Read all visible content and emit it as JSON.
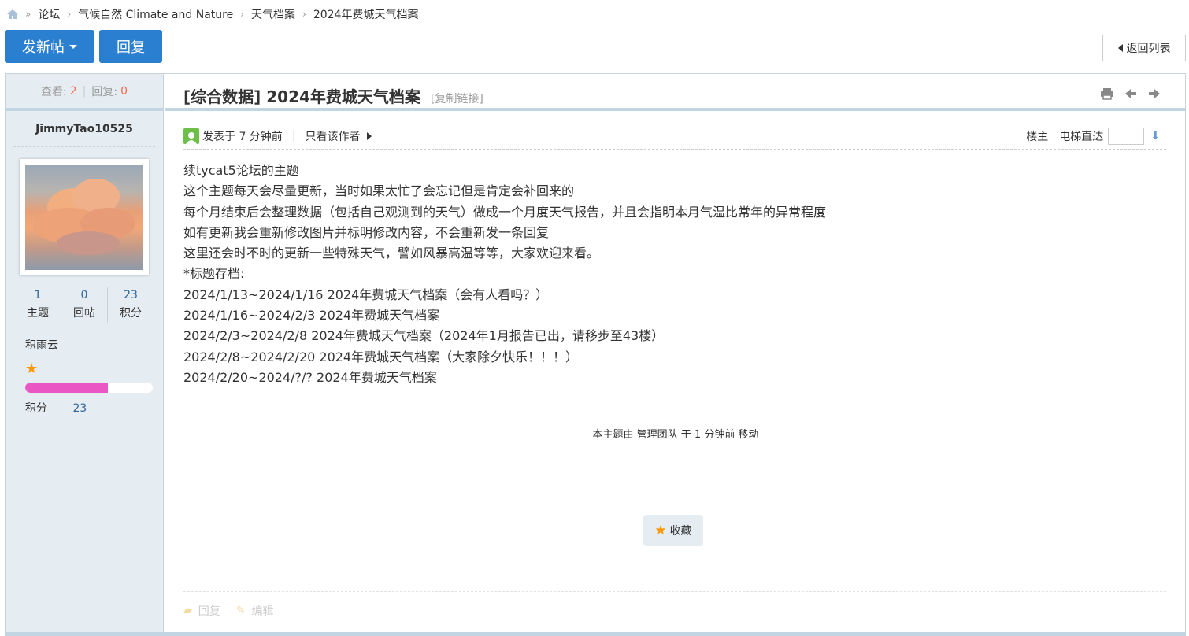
{
  "breadcrumb": {
    "items": [
      "论坛",
      "气候自然 Climate and Nature",
      "天气档案",
      "2024年费城天气档案"
    ],
    "separator": "»",
    "arrow": "›"
  },
  "toolbar": {
    "new_post_label": "发新帖",
    "reply_label": "回复",
    "back_label": "返回列表"
  },
  "thread_stats": {
    "views_label": "查看:",
    "views": "2",
    "replies_label": "回复:",
    "replies": "0"
  },
  "thread": {
    "category": "[综合数据]",
    "title": "2024年费城天气档案",
    "copy_link": "[复制链接]"
  },
  "author": {
    "name": "JimmyTao10525",
    "stats": [
      {
        "value": "1",
        "label": "主题"
      },
      {
        "value": "0",
        "label": "回帖"
      },
      {
        "value": "23",
        "label": "积分"
      }
    ],
    "group": "积雨云",
    "level_progress": 0.65,
    "points_label": "积分",
    "points": "23"
  },
  "post": {
    "posted_at": "发表于 7 分钟前",
    "only_author": "只看该作者",
    "floor": "楼主",
    "jump_label": "电梯直达",
    "lines": [
      "续tycat5论坛的主题",
      "这个主题每天会尽量更新，当时如果太忙了会忘记但是肯定会补回来的",
      "每个月结束后会整理数据（包括自己观测到的天气）做成一个月度天气报告，并且会指明本月气温比常年的异常程度",
      "如有更新我会重新修改图片并标明修改内容，不会重新发一条回复",
      "这里还会时不时的更新一些特殊天气，譬如风暴高温等等，大家欢迎来看。",
      "*标题存档:",
      "2024/1/13~2024/1/16 2024年费城天气档案（会有人看吗？）",
      "2024/1/16~2024/2/3 2024年费城天气档案",
      "2024/2/3~2024/2/8 2024年费城天气档案（2024年1月报告已出，请移步至43楼）",
      "2024/2/8~2024/2/20 2024年费城天气档案（大家除夕快乐！！！）",
      "2024/2/20~2024/?/? 2024年费城天气档案"
    ],
    "moved_notice": "本主题由 管理团队 于 1 分钟前 移动",
    "favorite_label": "收藏",
    "foot_reply": "回复",
    "foot_edit": "编辑"
  },
  "colors": {
    "accent": "#2b7fd0",
    "sidebar_bg": "#e5edf2",
    "count_red": "#f26c4f",
    "progress_pink": "#ea57c5",
    "star": "#ff9900"
  }
}
